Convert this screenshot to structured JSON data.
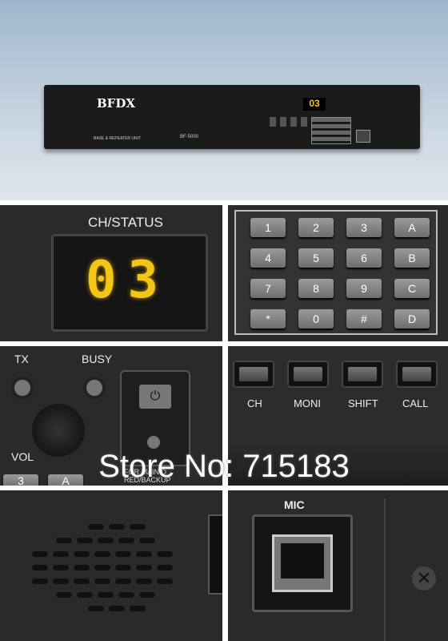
{
  "hero": {
    "brand": "BFDX",
    "unit_label": "BASE & REPEATER UNIT",
    "model": "BF-5000",
    "display": "03"
  },
  "channel_panel": {
    "title": "CH/STATUS",
    "display": "03"
  },
  "keypad": {
    "keys": [
      "1",
      "2",
      "3",
      "A",
      "4",
      "5",
      "6",
      "B",
      "7",
      "8",
      "9",
      "C",
      "*",
      "0",
      "#",
      "D"
    ]
  },
  "controls": {
    "tx": "TX",
    "busy": "BUSY",
    "vol": "VOL",
    "switch_label_1": "FOR MAIN D",
    "switch_label_2": "RED/BACKUP",
    "keys_partial": [
      "3",
      "A"
    ]
  },
  "function_buttons": [
    "CH",
    "MONI",
    "SHIFT",
    "CALL"
  ],
  "mic_panel": {
    "title": "MIC"
  },
  "watermark": "Store No: 715183",
  "colors": {
    "display": "#f2c619",
    "panel": "#2a2a2b",
    "background": "#b6c7d8"
  }
}
